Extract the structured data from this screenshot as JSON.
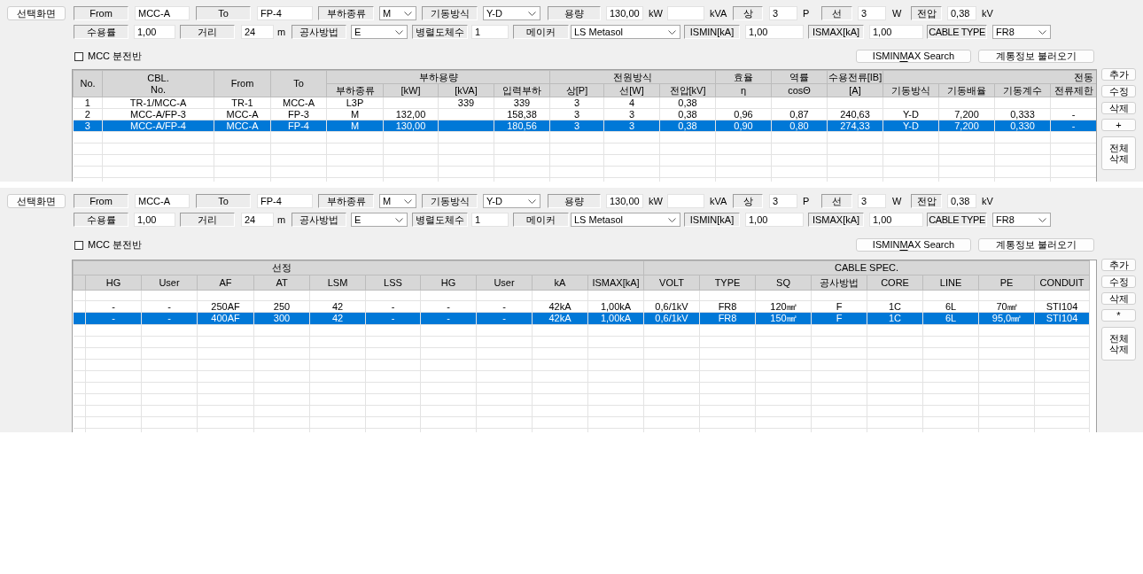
{
  "panels": [
    {
      "form_rows": [
        [
          {
            "kind": "button",
            "label": "선택화면"
          },
          {
            "kind": "label",
            "text": "From"
          },
          {
            "kind": "input",
            "value": "MCC-A"
          },
          {
            "kind": "label",
            "text": "To"
          },
          {
            "kind": "input",
            "value": "FP-4"
          },
          {
            "kind": "label",
            "text": "부하종류"
          },
          {
            "kind": "select",
            "value": "M"
          },
          {
            "kind": "label",
            "text": "기동방식"
          },
          {
            "kind": "select",
            "value": "Y-D"
          },
          {
            "kind": "label",
            "text": "용량"
          },
          {
            "kind": "input",
            "value": "130,00"
          },
          {
            "kind": "unit",
            "text": "kW"
          },
          {
            "kind": "input"
          },
          {
            "kind": "unit",
            "text": "kVA"
          },
          {
            "kind": "label",
            "text": "상"
          },
          {
            "kind": "input",
            "value": "3"
          },
          {
            "kind": "unit",
            "text": "P"
          },
          {
            "kind": "label",
            "text": "선"
          },
          {
            "kind": "input",
            "value": "3"
          },
          {
            "kind": "unit",
            "text": "W"
          },
          {
            "kind": "label",
            "text": "전압"
          },
          {
            "kind": "input",
            "value": "0,38"
          },
          {
            "kind": "unit",
            "text": "kV"
          }
        ],
        [
          {
            "kind": "label",
            "text": "수용률"
          },
          {
            "kind": "input",
            "value": "1,00"
          },
          {
            "kind": "label",
            "text": "거리"
          },
          {
            "kind": "input",
            "value": "24"
          },
          {
            "kind": "unit",
            "text": "m"
          },
          {
            "kind": "label",
            "text": "공사방법"
          },
          {
            "kind": "select",
            "value": "E"
          },
          {
            "kind": "label",
            "text": "병렬도체수"
          },
          {
            "kind": "input",
            "value": "1"
          },
          {
            "kind": "label",
            "text": "메이커"
          },
          {
            "kind": "select",
            "value": "LS Metasol"
          },
          {
            "kind": "label",
            "text": "ISMIN[kA]"
          },
          {
            "kind": "input",
            "value": "1,00"
          },
          {
            "kind": "label",
            "text": "ISMAX[kA]"
          },
          {
            "kind": "input",
            "value": "1,00"
          },
          {
            "kind": "label",
            "text": "CABLE TYPE"
          },
          {
            "kind": "select",
            "value": "FR8"
          }
        ]
      ],
      "mcc_checkbox": {
        "label": "MCC 분전반",
        "checked": false
      },
      "buttons": [
        {
          "label_parts": [
            {
              "text": "ISMIN",
              "underlined": false
            },
            {
              "text": "M",
              "underlined": true
            },
            {
              "text": "AX Search",
              "underlined": false
            }
          ]
        },
        {
          "label_parts": [
            {
              "text": "계통정보 불러오기",
              "underlined": false
            }
          ]
        }
      ],
      "table": {
        "kind": "load",
        "header": [
          {
            "label": "No."
          },
          {
            "label": "CBL.\nNo."
          },
          {
            "label": "From"
          },
          {
            "label": "To"
          },
          {
            "label": "부하용량",
            "columns": [
              "부하종류",
              "[kW]",
              "[kVA]",
              "입력부하"
            ]
          },
          {
            "label": "전원방식",
            "columns": [
              "상[P]",
              "선[W]",
              "전압[kV]"
            ]
          },
          {
            "label": "효율",
            "columns": [
              "η"
            ]
          },
          {
            "label": "역률",
            "columns": [
              "cosΘ"
            ]
          },
          {
            "label": "수용전류[IB]",
            "columns": [
              "[A]"
            ]
          },
          {
            "label": "전동",
            "columns": [
              "기동방식",
              "기동배율",
              "기동계수",
              "전류제한"
            ]
          }
        ],
        "rows": [
          {
            "selected": false,
            "cells": [
              "1",
              "TR-1/MCC-A",
              "TR-1",
              "MCC-A",
              "L3P",
              null,
              "339",
              "339",
              "3",
              "4",
              "0,38",
              null,
              null,
              null,
              null,
              null,
              null,
              null
            ]
          },
          {
            "selected": false,
            "cells": [
              "2",
              "MCC-A/FP-3",
              "MCC-A",
              "FP-3",
              "M",
              "132,00",
              null,
              "158,38",
              "3",
              "3",
              "0,38",
              "0,96",
              "0,87",
              "240,63",
              "Y-D",
              "7,200",
              "0,333",
              "-"
            ]
          },
          {
            "selected": true,
            "cells": [
              "3",
              "MCC-A/FP-4",
              "MCC-A",
              "FP-4",
              "M",
              "130,00",
              null,
              "180,56",
              "3",
              "3",
              "0,38",
              "0,90",
              "0,80",
              "274,33",
              "Y-D",
              "7,200",
              "0,330",
              "-"
            ]
          }
        ]
      },
      "side_buttons": [
        "추가",
        "수정",
        "삭제",
        "+",
        "전체\n삭제"
      ]
    },
    {
      "form_rows": [
        [
          {
            "kind": "button",
            "label": "선택화면"
          },
          {
            "kind": "label",
            "text": "From"
          },
          {
            "kind": "input",
            "value": "MCC-A"
          },
          {
            "kind": "label",
            "text": "To"
          },
          {
            "kind": "input",
            "value": "FP-4"
          },
          {
            "kind": "label",
            "text": "부하종류"
          },
          {
            "kind": "select",
            "value": "M"
          },
          {
            "kind": "label",
            "text": "기동방식"
          },
          {
            "kind": "select",
            "value": "Y-D"
          },
          {
            "kind": "label",
            "text": "용량"
          },
          {
            "kind": "input",
            "value": "130,00"
          },
          {
            "kind": "unit",
            "text": "kW"
          },
          {
            "kind": "input"
          },
          {
            "kind": "unit",
            "text": "kVA"
          },
          {
            "kind": "label",
            "text": "상"
          },
          {
            "kind": "input",
            "value": "3"
          },
          {
            "kind": "unit",
            "text": "P"
          },
          {
            "kind": "label",
            "text": "선"
          },
          {
            "kind": "input",
            "value": "3"
          },
          {
            "kind": "unit",
            "text": "W"
          },
          {
            "kind": "label",
            "text": "전압"
          },
          {
            "kind": "input",
            "value": "0,38"
          },
          {
            "kind": "unit",
            "text": "kV"
          }
        ],
        [
          {
            "kind": "label",
            "text": "수용률"
          },
          {
            "kind": "input",
            "value": "1,00"
          },
          {
            "kind": "label",
            "text": "거리"
          },
          {
            "kind": "input",
            "value": "24"
          },
          {
            "kind": "unit",
            "text": "m"
          },
          {
            "kind": "label",
            "text": "공사방법"
          },
          {
            "kind": "select",
            "value": "E"
          },
          {
            "kind": "label",
            "text": "병렬도체수"
          },
          {
            "kind": "input",
            "value": "1"
          },
          {
            "kind": "label",
            "text": "메이커"
          },
          {
            "kind": "select",
            "value": "LS Metasol"
          },
          {
            "kind": "label",
            "text": "ISMIN[kA]"
          },
          {
            "kind": "input",
            "value": "1,00"
          },
          {
            "kind": "label",
            "text": "ISMAX[kA]"
          },
          {
            "kind": "input",
            "value": "1,00"
          },
          {
            "kind": "label",
            "text": "CABLE TYPE"
          },
          {
            "kind": "select",
            "value": "FR8"
          }
        ]
      ],
      "mcc_checkbox": {
        "label": "MCC 분전반",
        "checked": false
      },
      "buttons": [
        {
          "label_parts": [
            {
              "text": "ISMIN",
              "underlined": false
            },
            {
              "text": "M",
              "underlined": true
            },
            {
              "text": "AX Search",
              "underlined": false
            }
          ]
        },
        {
          "label_parts": [
            {
              "text": "계통정보 불러오기",
              "underlined": false
            }
          ]
        }
      ],
      "table": {
        "kind": "spec",
        "header": [
          {
            "label": "선정",
            "columns": [
              "HG",
              "User",
              "AF",
              "AT",
              "LSM",
              "LSS",
              "HG",
              "User",
              "kA",
              "ISMAX[kA]"
            ]
          },
          {
            "label": "CABLE SPEC.",
            "columns": [
              "VOLT",
              "TYPE",
              "SQ",
              "공사방법",
              "CORE",
              "LINE",
              "PE",
              "CONDUIT"
            ]
          }
        ],
        "rows": [
          {
            "selected": false,
            "cells": [
              "-",
              "-",
              "250AF",
              "250",
              "42",
              "-",
              "-",
              "-",
              "42kA",
              "1,00kA",
              "0,6/1kV",
              "FR8",
              "120㎟",
              "F",
              "1C",
              "6L",
              "70㎟",
              "STI104"
            ]
          },
          {
            "selected": true,
            "cells": [
              "-",
              "-",
              "400AF",
              "300",
              "42",
              "-",
              "-",
              "-",
              "42kA",
              "1,00kA",
              "0,6/1kV",
              "FR8",
              "150㎟",
              "F",
              "1C",
              "6L",
              "95,0㎟",
              "STI104"
            ]
          }
        ]
      },
      "side_buttons": [
        "추가",
        "수정",
        "삭제",
        "*",
        "전체\n삭제"
      ]
    }
  ]
}
